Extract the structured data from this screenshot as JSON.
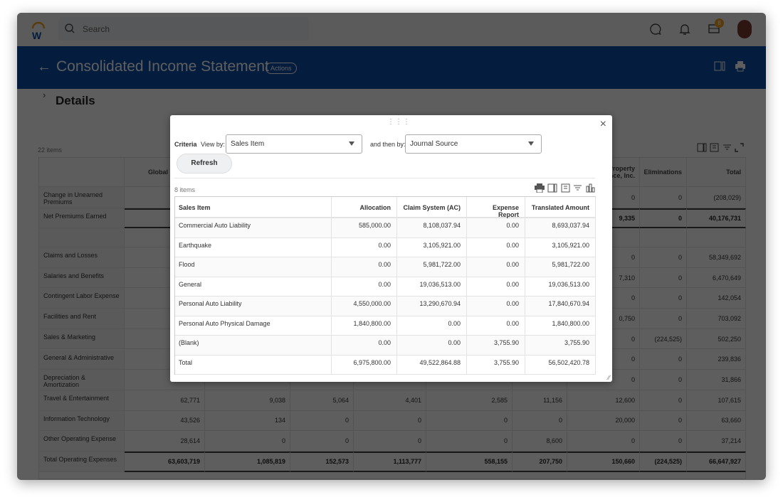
{
  "topbar": {
    "search_placeholder": "Search",
    "notification_count": "8"
  },
  "header": {
    "title": "Consolidated Income Statement",
    "actions_label": "Actions"
  },
  "section": {
    "title": "Details",
    "item_count": "22 items"
  },
  "report": {
    "columns": [
      "",
      "Global Insurance",
      "",
      "",
      "",
      "",
      "",
      "Property\nnce, Inc.",
      "Eliminations",
      "Total"
    ],
    "rows": [
      {
        "label": "Change in Unearned Premiums",
        "cells": [
          {
            "v": ""
          },
          {
            "v": ""
          },
          {
            "v": ""
          },
          {
            "v": ""
          },
          {
            "v": ""
          },
          {
            "v": ""
          },
          {
            "v": "0"
          },
          {
            "v": "0"
          },
          {
            "v": "(208,029)",
            "link": true
          }
        ]
      },
      {
        "label": "Net Premiums Earned",
        "bold": true,
        "cells": [
          {
            "v": ""
          },
          {
            "v": ""
          },
          {
            "v": ""
          },
          {
            "v": ""
          },
          {
            "v": ""
          },
          {
            "v": ""
          },
          {
            "v": "9,335"
          },
          {
            "v": "0"
          },
          {
            "v": "40,176,731"
          }
        ]
      },
      {
        "label": "",
        "cells": [
          {
            "v": ""
          },
          {
            "v": ""
          },
          {
            "v": ""
          },
          {
            "v": ""
          },
          {
            "v": ""
          },
          {
            "v": ""
          },
          {
            "v": ""
          },
          {
            "v": ""
          },
          {
            "v": ""
          }
        ]
      },
      {
        "label": "Claims and Losses",
        "cells": [
          {
            "v": ""
          },
          {
            "v": ""
          },
          {
            "v": ""
          },
          {
            "v": ""
          },
          {
            "v": ""
          },
          {
            "v": ""
          },
          {
            "v": "0"
          },
          {
            "v": "0"
          },
          {
            "v": "58,349,692",
            "link": true
          }
        ]
      },
      {
        "label": "Salaries and Benefits",
        "cells": [
          {
            "v": ""
          },
          {
            "v": ""
          },
          {
            "v": ""
          },
          {
            "v": ""
          },
          {
            "v": ""
          },
          {
            "v": ""
          },
          {
            "v": "7,310",
            "link": true
          },
          {
            "v": "0"
          },
          {
            "v": "6,470,649",
            "link": true
          }
        ]
      },
      {
        "label": "Contingent Labor Expense",
        "cells": [
          {
            "v": ""
          },
          {
            "v": ""
          },
          {
            "v": ""
          },
          {
            "v": ""
          },
          {
            "v": ""
          },
          {
            "v": ""
          },
          {
            "v": "0"
          },
          {
            "v": "0"
          },
          {
            "v": "142,054",
            "link": true
          }
        ]
      },
      {
        "label": "Facilities and Rent",
        "cells": [
          {
            "v": ""
          },
          {
            "v": ""
          },
          {
            "v": ""
          },
          {
            "v": ""
          },
          {
            "v": ""
          },
          {
            "v": ""
          },
          {
            "v": "0,750",
            "link": true
          },
          {
            "v": "0"
          },
          {
            "v": "703,092",
            "link": true
          }
        ]
      },
      {
        "label": "Sales & Marketing",
        "cells": [
          {
            "v": ""
          },
          {
            "v": ""
          },
          {
            "v": ""
          },
          {
            "v": ""
          },
          {
            "v": ""
          },
          {
            "v": ""
          },
          {
            "v": "0"
          },
          {
            "v": "(224,525)",
            "link": true
          },
          {
            "v": "502,250",
            "link": true
          }
        ]
      },
      {
        "label": "General & Administrative",
        "cells": [
          {
            "v": ""
          },
          {
            "v": ""
          },
          {
            "v": ""
          },
          {
            "v": ""
          },
          {
            "v": ""
          },
          {
            "v": ""
          },
          {
            "v": "0"
          },
          {
            "v": "0"
          },
          {
            "v": "239,836",
            "link": true
          }
        ]
      },
      {
        "label": "Depreciation & Amortization",
        "cells": [
          {
            "v": ""
          },
          {
            "v": ""
          },
          {
            "v": ""
          },
          {
            "v": ""
          },
          {
            "v": ""
          },
          {
            "v": ""
          },
          {
            "v": "0"
          },
          {
            "v": "0"
          },
          {
            "v": "31,866",
            "link": true
          }
        ]
      },
      {
        "label": "Travel & Entertainment",
        "cells": [
          {
            "v": "62,771",
            "link": true
          },
          {
            "v": "9,038",
            "link": true
          },
          {
            "v": "5,064",
            "link": true
          },
          {
            "v": "4,401",
            "link": true
          },
          {
            "v": "2,585",
            "link": true
          },
          {
            "v": "11,156",
            "link": true
          },
          {
            "v": "12,600",
            "link": true
          },
          {
            "v": "0"
          },
          {
            "v": "107,615",
            "link": true
          }
        ]
      },
      {
        "label": "Information Technology",
        "cells": [
          {
            "v": "43,526",
            "link": true
          },
          {
            "v": "134",
            "link": true
          },
          {
            "v": "0"
          },
          {
            "v": "0"
          },
          {
            "v": "0"
          },
          {
            "v": "0"
          },
          {
            "v": "20,000",
            "link": true
          },
          {
            "v": "0"
          },
          {
            "v": "63,660",
            "link": true
          }
        ]
      },
      {
        "label": "Other Operating Expense",
        "cells": [
          {
            "v": "28,614",
            "link": true
          },
          {
            "v": "0"
          },
          {
            "v": "0"
          },
          {
            "v": "0",
            "link": true
          },
          {
            "v": "0"
          },
          {
            "v": "8,600",
            "link": true
          },
          {
            "v": "0"
          },
          {
            "v": "0",
            "link": true
          },
          {
            "v": "37,214",
            "link": true
          }
        ]
      },
      {
        "label": "Total Operating Expenses",
        "bold": true,
        "cells": [
          {
            "v": "63,603,719"
          },
          {
            "v": "1,085,819"
          },
          {
            "v": "152,573"
          },
          {
            "v": "1,113,777"
          },
          {
            "v": "558,155"
          },
          {
            "v": "207,750"
          },
          {
            "v": "150,660"
          },
          {
            "v": "(224,525)"
          },
          {
            "v": "66,647,927"
          }
        ]
      }
    ]
  },
  "modal": {
    "criteria_label": "Criteria",
    "view_by_label": "View by:",
    "view_by_value": "Sales Item",
    "then_by_label": "and then by:",
    "then_by_value": "Journal Source",
    "refresh_label": "Refresh",
    "item_count": "8 items",
    "columns": [
      "Sales Item",
      "Allocation",
      "Claim System (AC)",
      "Expense Report",
      "Translated Amount"
    ],
    "rows": [
      {
        "cells": [
          {
            "v": "Commercial Auto Liability",
            "link": true
          },
          {
            "v": "585,000.00",
            "link": true
          },
          {
            "v": "8,108,037.94",
            "link": true
          },
          {
            "v": "0.00"
          },
          {
            "v": "8,693,037.94",
            "link": true
          }
        ]
      },
      {
        "cells": [
          {
            "v": "Earthquake",
            "link": true
          },
          {
            "v": "0.00"
          },
          {
            "v": "3,105,921.00",
            "link": true
          },
          {
            "v": "0.00"
          },
          {
            "v": "3,105,921.00",
            "link": true
          }
        ]
      },
      {
        "cells": [
          {
            "v": "Flood",
            "link": true
          },
          {
            "v": "0.00"
          },
          {
            "v": "5,981,722.00",
            "link": true
          },
          {
            "v": "0.00"
          },
          {
            "v": "5,981,722.00",
            "link": true
          }
        ]
      },
      {
        "cells": [
          {
            "v": "General",
            "link": true
          },
          {
            "v": "0.00"
          },
          {
            "v": "19,036,513.00",
            "link": true
          },
          {
            "v": "0.00"
          },
          {
            "v": "19,036,513.00",
            "link": true
          }
        ]
      },
      {
        "cells": [
          {
            "v": "Personal Auto Liability",
            "link": true
          },
          {
            "v": "4,550,000.00",
            "link": true
          },
          {
            "v": "13,290,670.94",
            "link": true
          },
          {
            "v": "0.00"
          },
          {
            "v": "17,840,670.94",
            "link": true
          }
        ]
      },
      {
        "cells": [
          {
            "v": "Personal Auto Physical Damage",
            "link": true
          },
          {
            "v": "1,840,800.00",
            "link": true
          },
          {
            "v": "0.00"
          },
          {
            "v": "0.00"
          },
          {
            "v": "1,840,800.00",
            "link": true
          }
        ]
      },
      {
        "cells": [
          {
            "v": "(Blank)"
          },
          {
            "v": "0.00"
          },
          {
            "v": "0.00"
          },
          {
            "v": "3,755.90",
            "link": true
          },
          {
            "v": "3,755.90",
            "link": true
          }
        ]
      },
      {
        "cells": [
          {
            "v": "Total"
          },
          {
            "v": "6,975,800.00",
            "link": true
          },
          {
            "v": "49,522,864.88",
            "link": true
          },
          {
            "v": "3,755.90",
            "link": true
          },
          {
            "v": "56,502,420.78",
            "link": true
          }
        ]
      }
    ]
  },
  "colors": {
    "brand_blue": "#0b4fa8",
    "link": "#2f6fbf",
    "badge": "#f0a020"
  }
}
